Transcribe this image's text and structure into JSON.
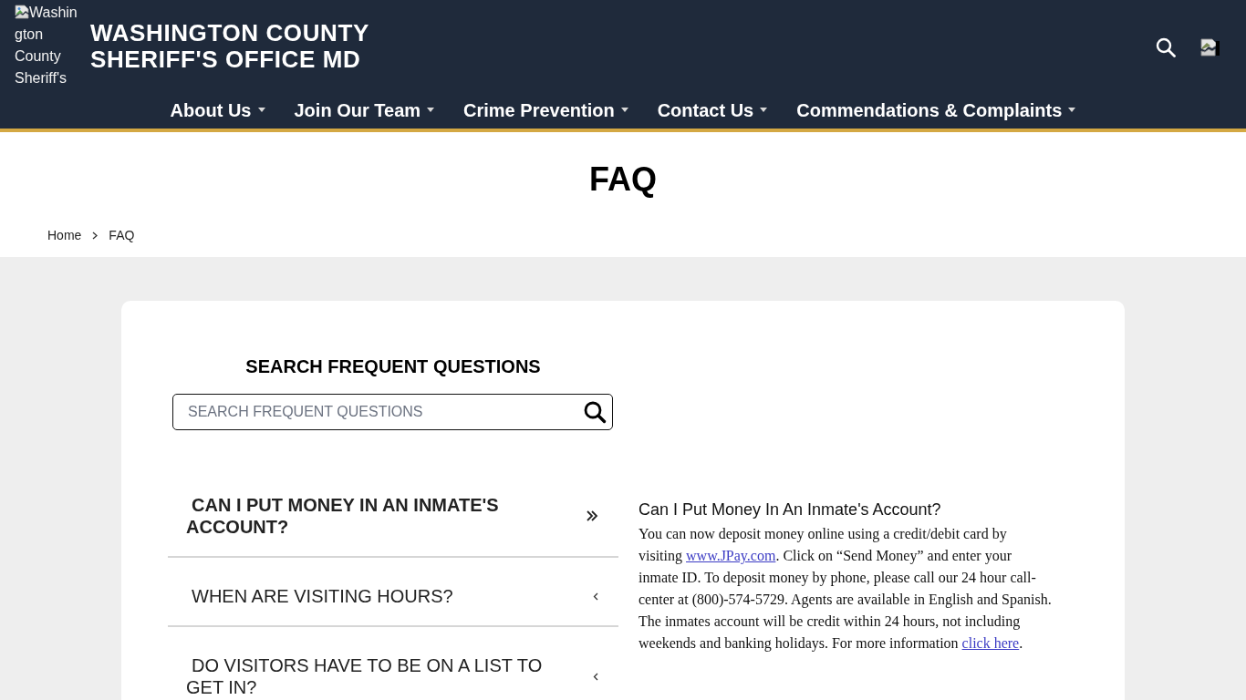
{
  "header": {
    "logo_alt_text": "Washington County Sheriff's",
    "site_title": "WASHINGTON COUNTY SHERIFF'S OFFICE MD",
    "nav": [
      {
        "label": "About Us"
      },
      {
        "label": "Join Our Team"
      },
      {
        "label": "Crime Prevention"
      },
      {
        "label": "Contact Us"
      },
      {
        "label": "Commendations & Complaints"
      }
    ]
  },
  "page_title": "FAQ",
  "breadcrumb": [
    {
      "label": "Home"
    },
    {
      "label": "FAQ"
    }
  ],
  "faq": {
    "search_heading": "SEARCH FREQUENT QUESTIONS",
    "search": {
      "placeholder": "SEARCH FREQUENT QUESTIONS"
    },
    "questions": [
      {
        "text": "CAN I PUT MONEY IN AN INMATE'S ACCOUNT?",
        "selected": true
      },
      {
        "text": "WHEN ARE VISITING HOURS?",
        "selected": false
      },
      {
        "text": "DO VISITORS HAVE TO BE ON A LIST TO GET IN?",
        "selected": false
      }
    ],
    "answer": {
      "title": "Can I Put Money In An Inmate's Account?",
      "body": [
        {
          "kind": "text",
          "text": "You can now deposit money online using a credit/debit card by visiting "
        },
        {
          "kind": "link",
          "text": "www.JPay.com"
        },
        {
          "kind": "text",
          "text": ". Click on “Send Money” and enter your inmate ID. To deposit money by phone, please call our 24 hour call-center at (800)-574-5729. Agents are available in English and Spanish. The inmates account will be credit within 24 hours, not including weekends and banking holidays. For more information "
        },
        {
          "kind": "link",
          "text": "click here"
        },
        {
          "kind": "text",
          "text": "."
        }
      ]
    }
  }
}
